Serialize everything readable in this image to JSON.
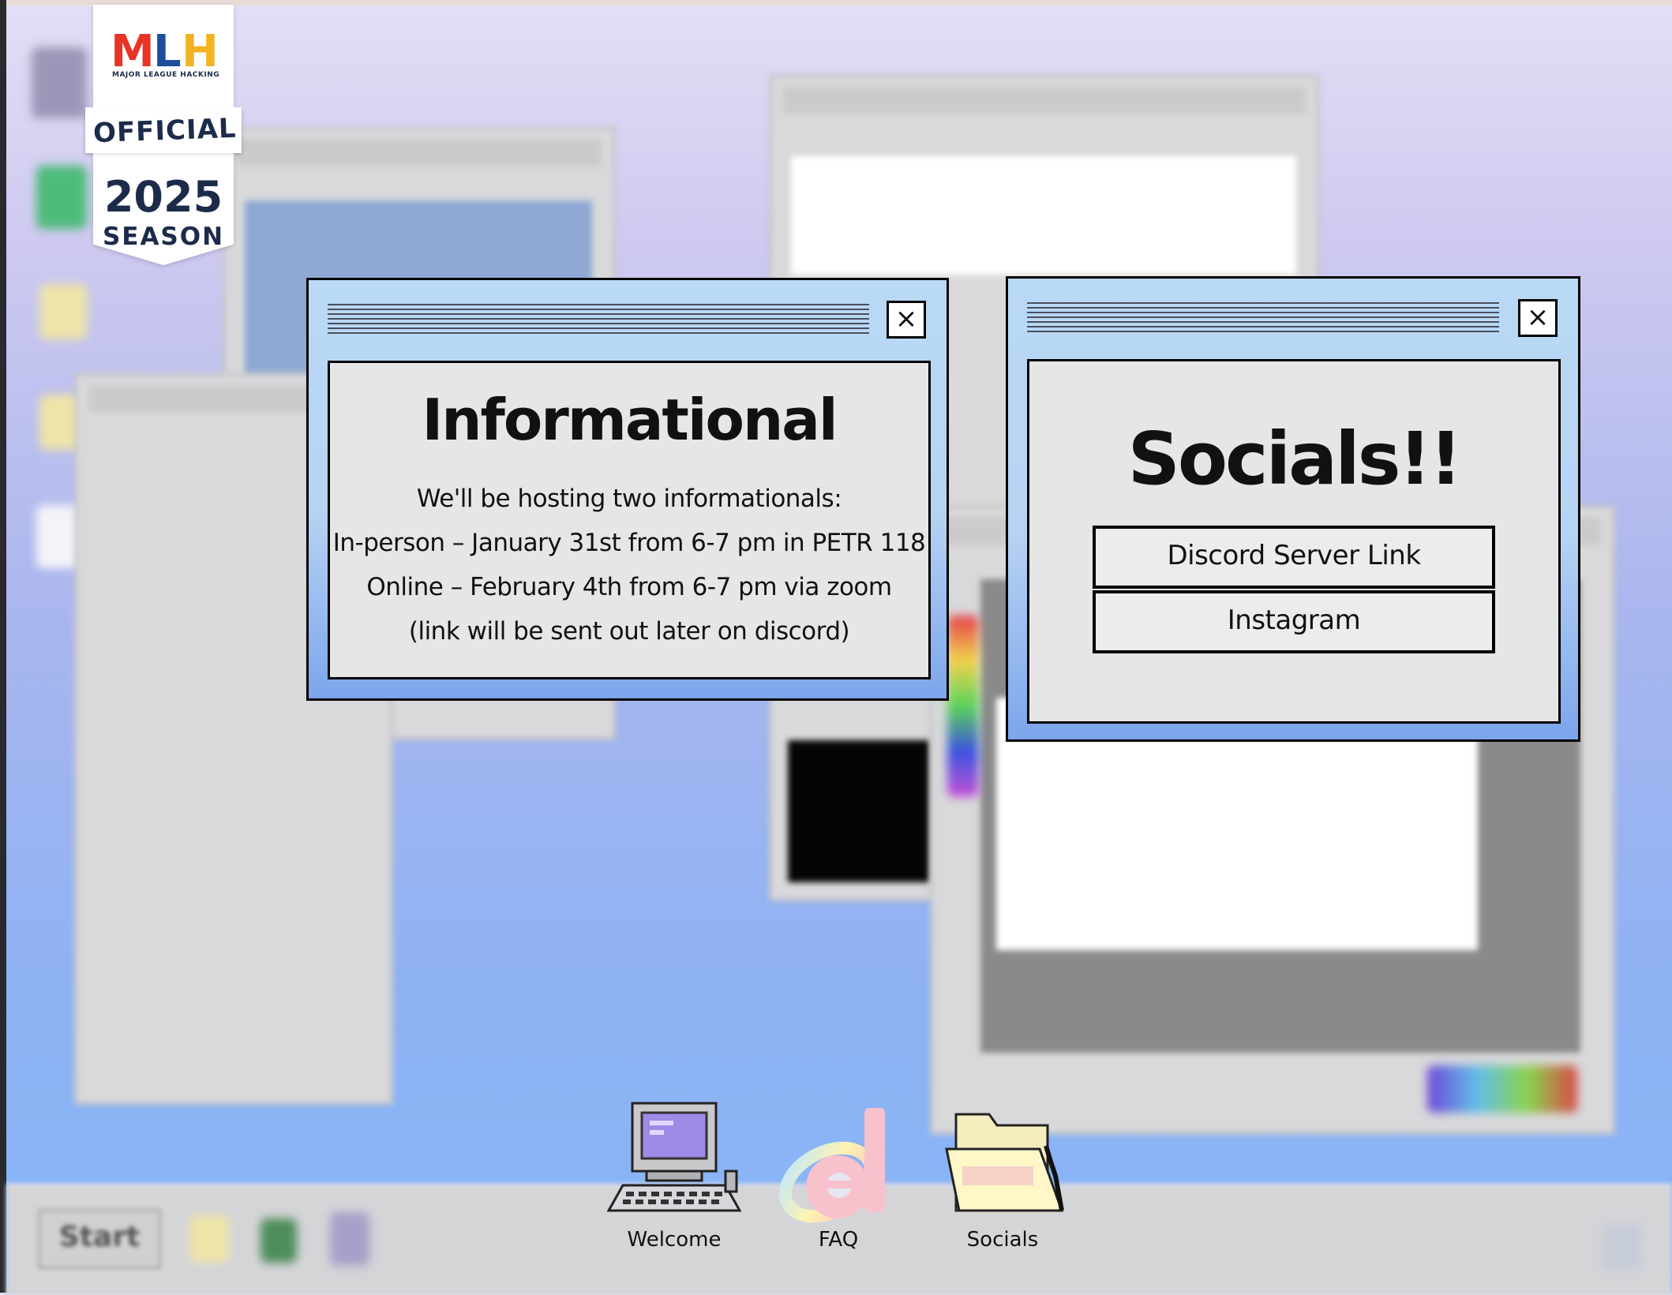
{
  "badge": {
    "logo": "MLH",
    "subtitle": "MAJOR LEAGUE HACKING",
    "official": "OFFICIAL",
    "year": "2025",
    "season": "SEASON"
  },
  "informational": {
    "title": "Informational",
    "lines": [
      "We'll be hosting two informationals:",
      "In-person – January 31st from 6-7 pm in PETR 118",
      "Online – February 4th from 6-7 pm via zoom",
      "(link will be sent out later on discord)"
    ],
    "close": "×"
  },
  "socials": {
    "title": "Socials!!",
    "buttons": [
      "Discord Server Link",
      "Instagram"
    ],
    "close": "×"
  },
  "dock": [
    {
      "label": "Welcome",
      "icon": "computer-icon"
    },
    {
      "label": "FAQ",
      "icon": "internet-explorer-icon"
    },
    {
      "label": "Socials",
      "icon": "folder-icon"
    }
  ],
  "taskbar": {
    "start_label": "Start"
  },
  "colors": {
    "dialog_top": "#b9d9f5",
    "dialog_bottom": "#7da5ec",
    "panel": "#e6e6e6",
    "mlh_red": "#e73427",
    "mlh_blue": "#1d4e9e",
    "mlh_yellow": "#f2b323",
    "badge_navy": "#1d2b4a"
  }
}
